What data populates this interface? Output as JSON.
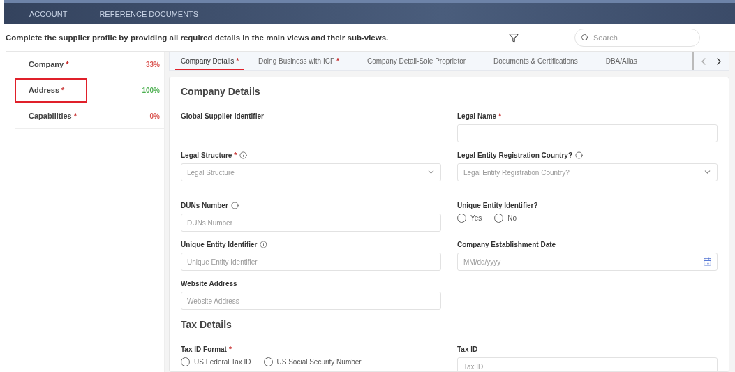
{
  "nav": {
    "items": [
      {
        "label": "ACCOUNT"
      },
      {
        "label": "REFERENCE DOCUMENTS"
      }
    ]
  },
  "instruction": "Complete the supplier profile by providing all required details in the main views and their sub-views.",
  "search": {
    "placeholder": "Search"
  },
  "sidebar": {
    "items": [
      {
        "label": "Company",
        "mark": "*",
        "percent": "33%",
        "color": "#d9534f",
        "highlighted": false
      },
      {
        "label": "Address",
        "mark": "*",
        "percent": "100%",
        "color": "#4caf50",
        "highlighted": true
      },
      {
        "label": "Capabilities",
        "mark": "*",
        "percent": "0%",
        "color": "#d9534f",
        "highlighted": false
      }
    ]
  },
  "tabs": [
    {
      "label": "Company Details",
      "mark": "*",
      "selected": true
    },
    {
      "label": "Doing Business with ICF",
      "mark": "*",
      "selected": false
    },
    {
      "label": "Company Detail-Sole Proprietor",
      "selected": false
    },
    {
      "label": "Documents & Certifications",
      "selected": false
    },
    {
      "label": "DBA/Alias",
      "selected": false
    }
  ],
  "sections": [
    {
      "title": "Company Details",
      "rows": [
        [
          {
            "kind": "readonly",
            "label": "Global Supplier Identifier",
            "info": false
          },
          {
            "kind": "text",
            "label": "Legal Name",
            "mark": "*",
            "info": false
          }
        ],
        [
          {
            "kind": "select",
            "label": "Legal Structure",
            "mark": "*",
            "info": true,
            "placeholder": "Legal Structure"
          },
          {
            "kind": "select",
            "label": "Legal Entity Registration Country?",
            "info": true,
            "placeholder": "Legal Entity Registration Country?"
          }
        ],
        [
          {
            "kind": "text",
            "label": "DUNs Number",
            "info": true,
            "placeholder": "DUNs Number"
          },
          {
            "kind": "radio",
            "label": "Unique Entity Identifier?",
            "info": false,
            "options": [
              {
                "label": "Yes",
                "selected": false
              },
              {
                "label": "No",
                "selected": false
              }
            ]
          }
        ],
        [
          {
            "kind": "text",
            "label": "Unique Entity Identifier",
            "info": true,
            "placeholder": "Unique Entity Identifier"
          },
          {
            "kind": "date",
            "label": "Company Establishment Date",
            "info": false,
            "placeholder": "MM/dd/yyyy"
          }
        ],
        [
          {
            "kind": "text",
            "label": "Website Address",
            "info": false,
            "placeholder": "Website Address"
          }
        ]
      ]
    },
    {
      "title": "Tax Details",
      "rows": [
        [
          {
            "kind": "radio",
            "label": "Tax ID Format",
            "mark": "*",
            "info": false,
            "options": [
              {
                "label": "US Federal Tax ID",
                "selected": false
              },
              {
                "label": "US Social Security Number",
                "selected": false
              }
            ]
          },
          {
            "kind": "text",
            "label": "Tax ID",
            "info": false,
            "placeholder": "Tax ID"
          }
        ]
      ]
    }
  ]
}
